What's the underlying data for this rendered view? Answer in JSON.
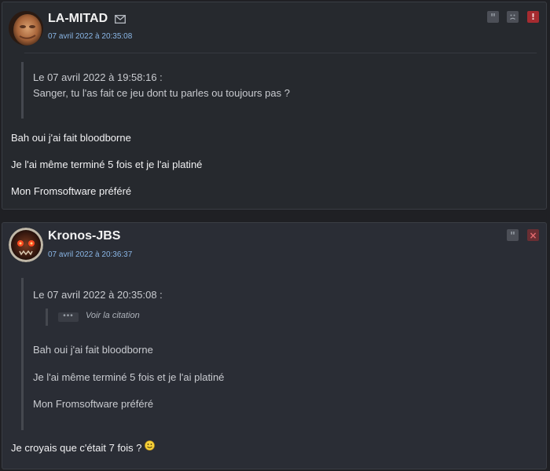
{
  "posts": [
    {
      "username": "LA-MITAD",
      "date": "07 avril 2022 à 20:35:08",
      "quote": {
        "header": "Le 07 avril 2022 à 19:58:16 :",
        "text": "Sanger, tu l'as fait ce jeu dont tu parles ou toujours pas ?"
      },
      "message": [
        "Bah oui j'ai fait bloodborne",
        "Je l'ai même terminé 5 fois et je l'ai platiné",
        "Mon Fromsoftware préféré"
      ],
      "actions": [
        "quote-button",
        "unhappy-button",
        "report-button"
      ]
    },
    {
      "username": "Kronos-JBS",
      "date": "07 avril 2022 à 20:36:37",
      "quote": {
        "header": "Le 07 avril 2022 à 20:35:08 :",
        "nested_dots": "•••",
        "nested_link": "Voir la citation",
        "lines": [
          "Bah oui j'ai fait bloodborne",
          "Je l'ai même terminé 5 fois et je l'ai platiné",
          "Mon Fromsoftware préféré"
        ]
      },
      "message": "Je croyais que c'était 7 fois ?",
      "actions": [
        "quote-button",
        "delete-button"
      ]
    }
  ],
  "colors": {
    "page_bg": "#1f2024",
    "post_bg": "#26292e",
    "date_link": "#8ab6e6",
    "report_red": "#a52b30"
  }
}
